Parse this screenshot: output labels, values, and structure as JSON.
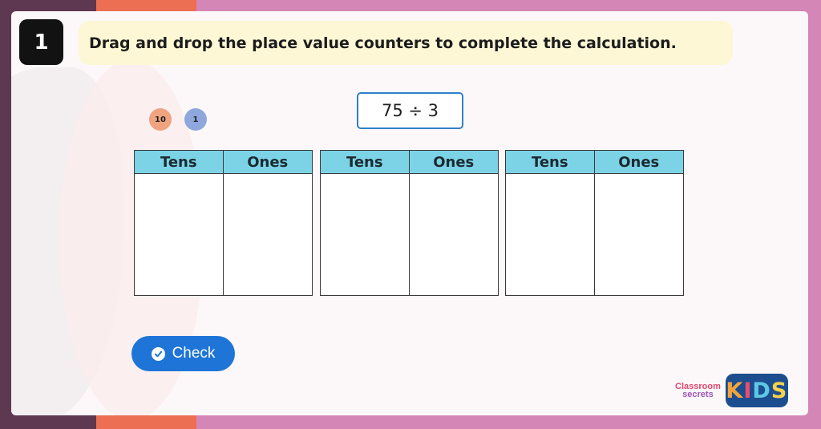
{
  "question_number": "1",
  "instruction": "Drag and drop the place value counters to complete the calculation.",
  "counters": [
    {
      "label": "10",
      "color": "#efa47f"
    },
    {
      "label": "1",
      "color": "#8ea8dd"
    }
  ],
  "calculation": "75 ÷ 3",
  "tables": [
    {
      "headers": [
        "Tens",
        "Ones"
      ]
    },
    {
      "headers": [
        "Tens",
        "Ones"
      ]
    },
    {
      "headers": [
        "Tens",
        "Ones"
      ]
    }
  ],
  "check_button": {
    "label": "Check",
    "icon": "check-circle-icon"
  },
  "logo": {
    "line1": "Classroom",
    "line2": "secrets",
    "badge": "KIDS"
  },
  "colors": {
    "accent_blue": "#1f74d8",
    "header_cyan": "#7dd3e6",
    "instruction_bg": "#fdf7d5",
    "frame_pink": "#d487b6"
  }
}
